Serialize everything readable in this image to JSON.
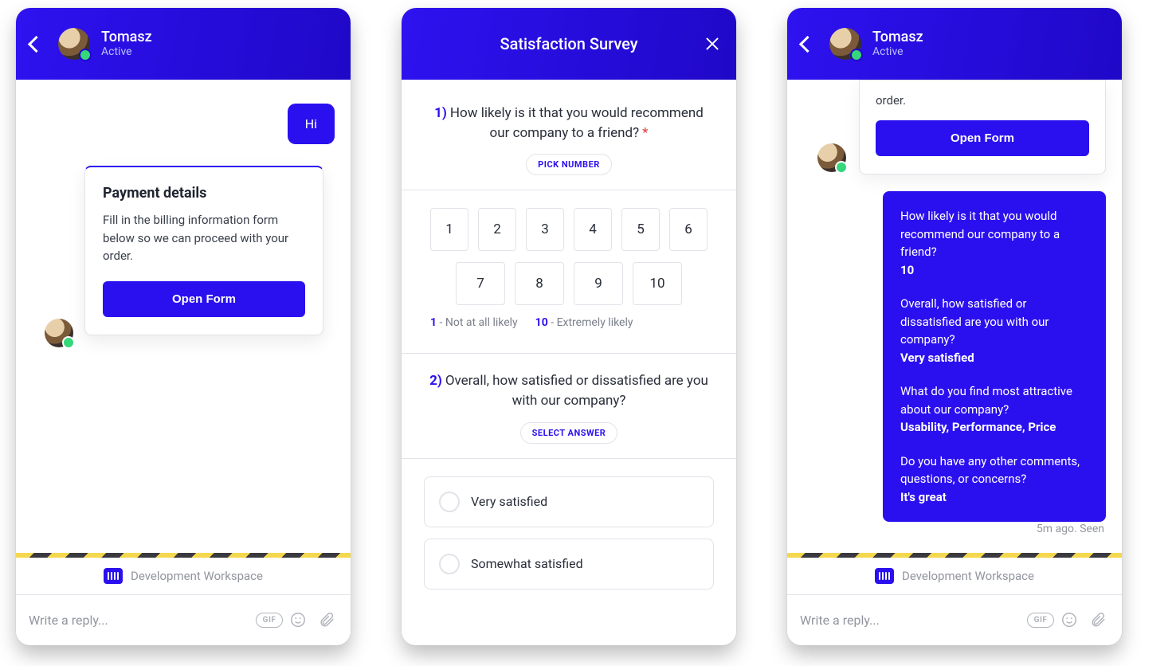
{
  "brand_color": "#2b10ef",
  "screen1": {
    "user": {
      "name": "Tomasz",
      "presence": "Active"
    },
    "outgoing_msg": "Hi",
    "card": {
      "title": "Payment details",
      "body": "Fill in the billing information form below so we can proceed with your order.",
      "cta": "Open Form"
    },
    "workspace_label": "Development Workspace",
    "reply_placeholder": "Write a reply...",
    "gif_label": "GIF"
  },
  "screen2": {
    "title": "Satisfaction Survey",
    "q1": {
      "num": "1)",
      "text": "How likely is it that you would recommend our company to a friend?",
      "required": "*",
      "pill": "PICK NUMBER",
      "options_row1": [
        "1",
        "2",
        "3",
        "4",
        "5",
        "6"
      ],
      "options_row2": [
        "7",
        "8",
        "9",
        "10"
      ],
      "legend_low_num": "1",
      "legend_low": " - Not at all likely",
      "legend_high_num": "10",
      "legend_high": " - Extremely likely"
    },
    "q2": {
      "num": "2)",
      "text": "Overall, how satisfied or dissatisfied are you with our company?",
      "pill": "SELECT ANSWER",
      "options": [
        "Very satisfied",
        "Somewhat satisfied"
      ]
    }
  },
  "screen3": {
    "user": {
      "name": "Tomasz",
      "presence": "Active"
    },
    "partial_card": {
      "trailing": "order.",
      "cta": "Open Form"
    },
    "answers": [
      {
        "q": "How likely is it that you would recommend our company to a friend?",
        "a": "10"
      },
      {
        "q": "Overall, how satisfied or dissatisfied are you with our company?",
        "a": "Very satisfied"
      },
      {
        "q": "What do you find most attractive about our company?",
        "a": "Usability, Performance, Price"
      },
      {
        "q": "Do you have any other comments, questions, or concerns?",
        "a": "It's great"
      }
    ],
    "timestamp": "5m ago. Seen",
    "workspace_label": "Development Workspace",
    "reply_placeholder": "Write a reply...",
    "gif_label": "GIF"
  }
}
